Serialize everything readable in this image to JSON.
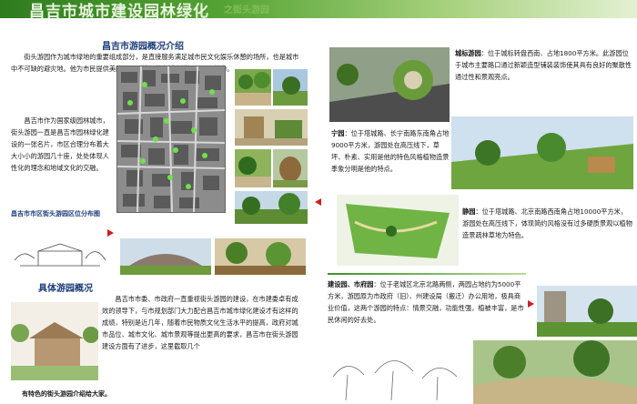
{
  "header": {
    "title": "昌吉市城市建设园林绿化",
    "subtitle": "之街头游园"
  },
  "left": {
    "overview_title": "昌吉市游园概况介绍",
    "intro_paragraphs": [
      "街头游园作为城市绿地的重要组成部分，是直接服务满足城市民文化娱乐休憩的场所，也是城市中不可缺的避灾地。他为市民提供美的景观环境，他为城市增添了不少魅力。",
      "昌吉市作为国家级园林城市，街头游园一直是昌吉市园林绿化建设的一张名片，市区合理分布着大大小小的游园几十座，处处体现人性化的理念和地域文化的交融。"
    ],
    "map_caption": "昌吉市市区街头游园区位分布图",
    "detail_title": "具体游园概况",
    "detail_text": "昌吉市市委、市政府一直重视街头游园的建设，在市建委卓有成效的领导下，与市规划部门大力配合昌吉市城市绿化建设才有这样的成绩，特别是近几年，随着市民物质文化生活水平的提高，政府对城市品位、城市文化、城市景观等提出更高的要求，昌吉市在街头游园建设方面有了进步，这里截取几个",
    "sketch_caption": "有特色的街头游园介绍给大家。"
  },
  "right": {
    "parks": [
      {
        "name": "城标游园",
        "text": "位于城标转盘西南、占地1800平方米。此游园位于城市主要路口通过新颖造型铺装装饰使其具有良好的聚散性通过性和景观亮点。"
      },
      {
        "name": "宁园",
        "text": "位于塔城路、长宁南路东南角占地9000平方米，游园处在高压线下，草坪、朴素、实用是他的特色风格植物造景季象分明是他的特点。"
      },
      {
        "name": "静园",
        "text": "位于塔城路、北京南路西南角占地10000平方米，游园处在高压线下，体现简约风格没有过多硬质景观以植物造景疏林草地为特色。"
      },
      {
        "name": "建设园、市府园",
        "text": "位于老城区北京北路两侧，两园占地约为5000平方米，游园原为市政府（旧）、州建设局（搬迁）办公用地，极具商业价值，这两个游园的特点：情景交融，功能性强，植被丰富，是市民休闲的好去处。"
      }
    ]
  },
  "colors": {
    "banner_green": "#55a334",
    "title_blue": "#1e3d7a",
    "arrow_red": "#d21c1c"
  }
}
